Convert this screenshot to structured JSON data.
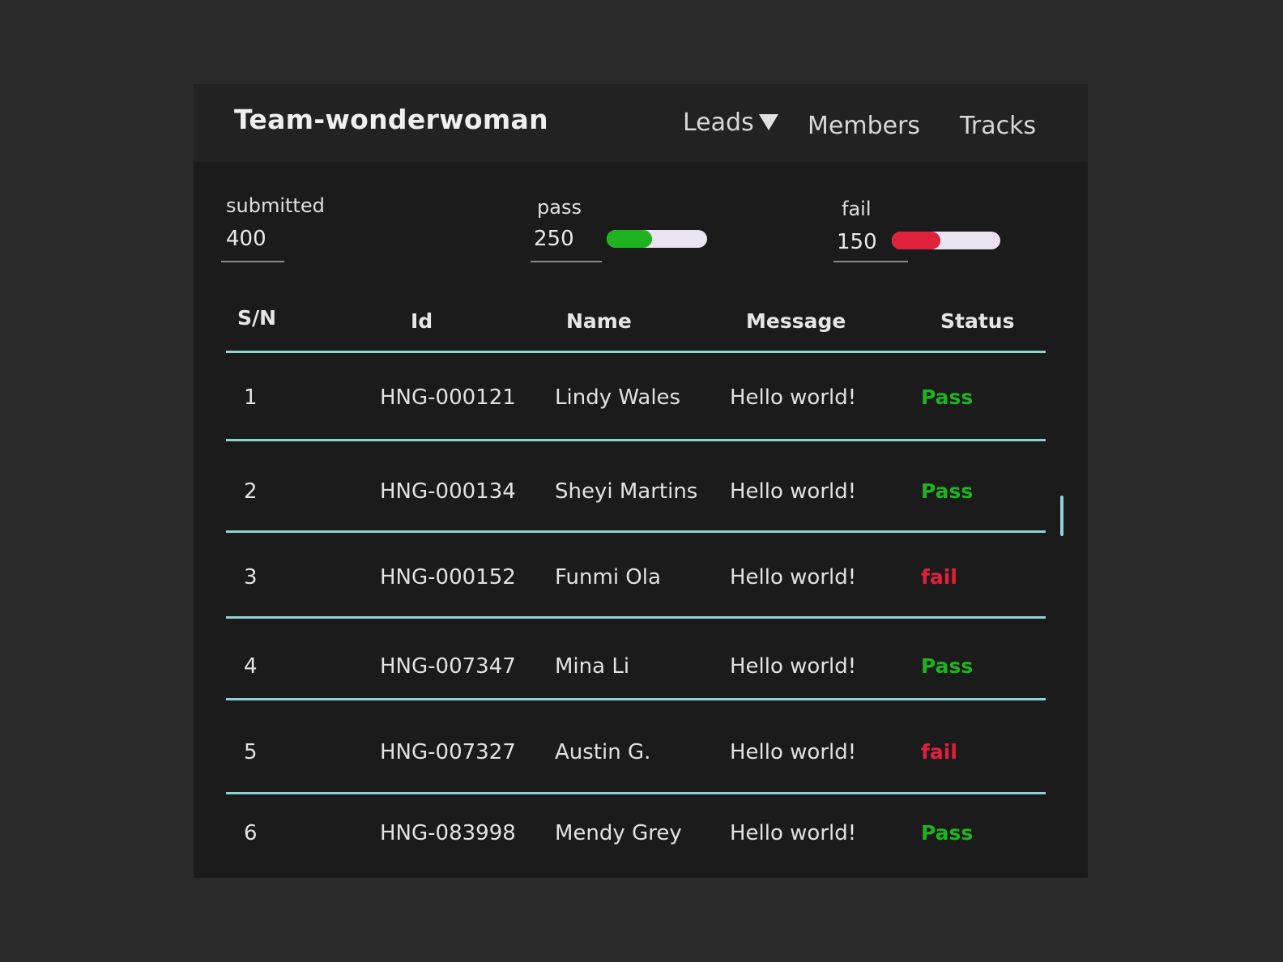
{
  "header": {
    "title": "Team-wonderwoman",
    "nav": [
      {
        "label": "Leads",
        "has_dropdown": true
      },
      {
        "label": "Members"
      },
      {
        "label": "Tracks"
      }
    ]
  },
  "stats": {
    "submitted": {
      "label": "submitted",
      "value": "400"
    },
    "pass": {
      "label": "pass",
      "value": "250",
      "bar_fraction": 0.45,
      "color": "#1fb31f"
    },
    "fail": {
      "label": "fail",
      "value": "150",
      "bar_fraction": 0.45,
      "color": "#e0213b"
    }
  },
  "table": {
    "columns": [
      "S/N",
      "Id",
      "Name",
      "Message",
      "Status"
    ],
    "rows": [
      {
        "sn": "1",
        "id": "HNG-000121",
        "name": "Lindy Wales",
        "message": "Hello world!",
        "status": "Pass"
      },
      {
        "sn": "2",
        "id": "HNG-000134",
        "name": "Sheyi Martins",
        "message": "Hello world!",
        "status": "Pass"
      },
      {
        "sn": "3",
        "id": "HNG-000152",
        "name": "Funmi Ola",
        "message": "Hello world!",
        "status": "fail"
      },
      {
        "sn": "4",
        "id": "HNG-007347",
        "name": "Mina Li",
        "message": "Hello world!",
        "status": "Pass"
      },
      {
        "sn": "5",
        "id": "HNG-007327",
        "name": "Austin G.",
        "message": "Hello world!",
        "status": "fail"
      },
      {
        "sn": "6",
        "id": "HNG-083998",
        "name": "Mendy Grey",
        "message": "Hello world!",
        "status": "Pass"
      }
    ]
  },
  "colors": {
    "pass": "#1fb31f",
    "fail": "#e0213b",
    "row_divider": "#8fd3d6"
  }
}
